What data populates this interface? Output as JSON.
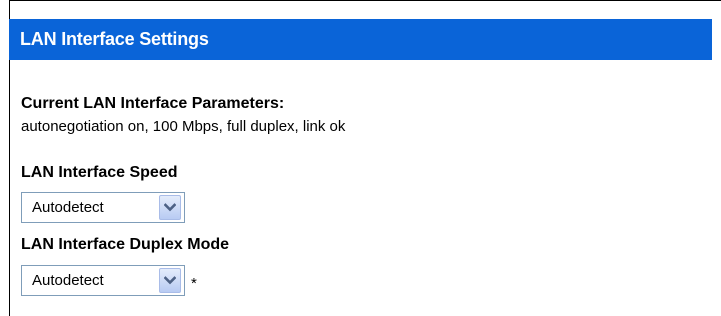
{
  "page": {
    "title": "LAN Interface Settings"
  },
  "current_params": {
    "heading": "Current LAN Interface Parameters:",
    "value": "autonegotiation on, 100 Mbps, full duplex, link ok"
  },
  "speed": {
    "label": "LAN Interface Speed",
    "selected": "Autodetect"
  },
  "duplex": {
    "label": "LAN Interface Duplex Mode",
    "selected": "Autodetect",
    "required_marker": "*"
  },
  "colors": {
    "title_bar": "#0a64d8",
    "title_text": "#ffffff",
    "select_border": "#7f9db9",
    "arrow": "#4d6185"
  },
  "icons": {
    "dropdown": "chevron-down-icon"
  }
}
